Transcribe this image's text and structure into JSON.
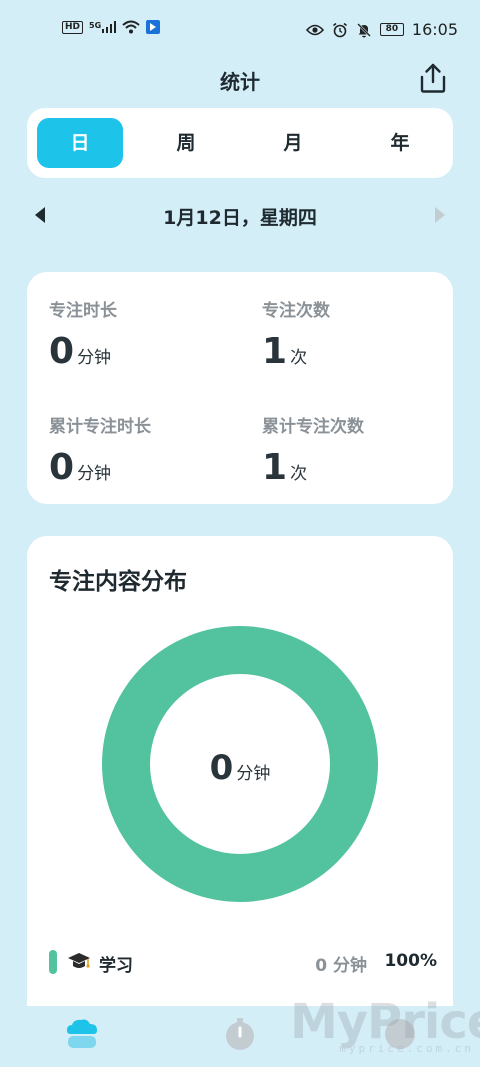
{
  "status_bar": {
    "hd_label": "HD",
    "network_label": "5G",
    "battery_level": "80",
    "time": "16:05"
  },
  "header": {
    "title": "统计"
  },
  "tabs": [
    {
      "label": "日",
      "active": true
    },
    {
      "label": "周",
      "active": false
    },
    {
      "label": "月",
      "active": false
    },
    {
      "label": "年",
      "active": false
    }
  ],
  "date_nav": {
    "date": "1月12日，星期四"
  },
  "stats": {
    "focus_duration": {
      "label": "专注时长",
      "value": "0",
      "unit": "分钟"
    },
    "focus_count": {
      "label": "专注次数",
      "value": "1",
      "unit": "次"
    },
    "total_duration": {
      "label": "累计专注时长",
      "value": "0",
      "unit": "分钟"
    },
    "total_count": {
      "label": "累计专注次数",
      "value": "1",
      "unit": "次"
    }
  },
  "distribution": {
    "title": "专注内容分布",
    "center_value": "0",
    "center_unit": "分钟",
    "ring_color": "#52c29f",
    "items": [
      {
        "icon": "graduation-cap-icon",
        "name": "学习",
        "duration": "0 分钟",
        "percent": "100%",
        "fraction": 1.0,
        "color": "#52c29f"
      }
    ]
  },
  "colors": {
    "accent": "#1ec3ea",
    "background": "#d4eef8"
  },
  "bottom_nav": [
    {
      "icon": "stats-cloud-icon",
      "active": true
    },
    {
      "icon": "timer-icon",
      "active": false
    },
    {
      "icon": "profile-icon",
      "active": false
    }
  ],
  "watermark": {
    "brand": "MyPrice",
    "url": "myprice.com.cn"
  }
}
